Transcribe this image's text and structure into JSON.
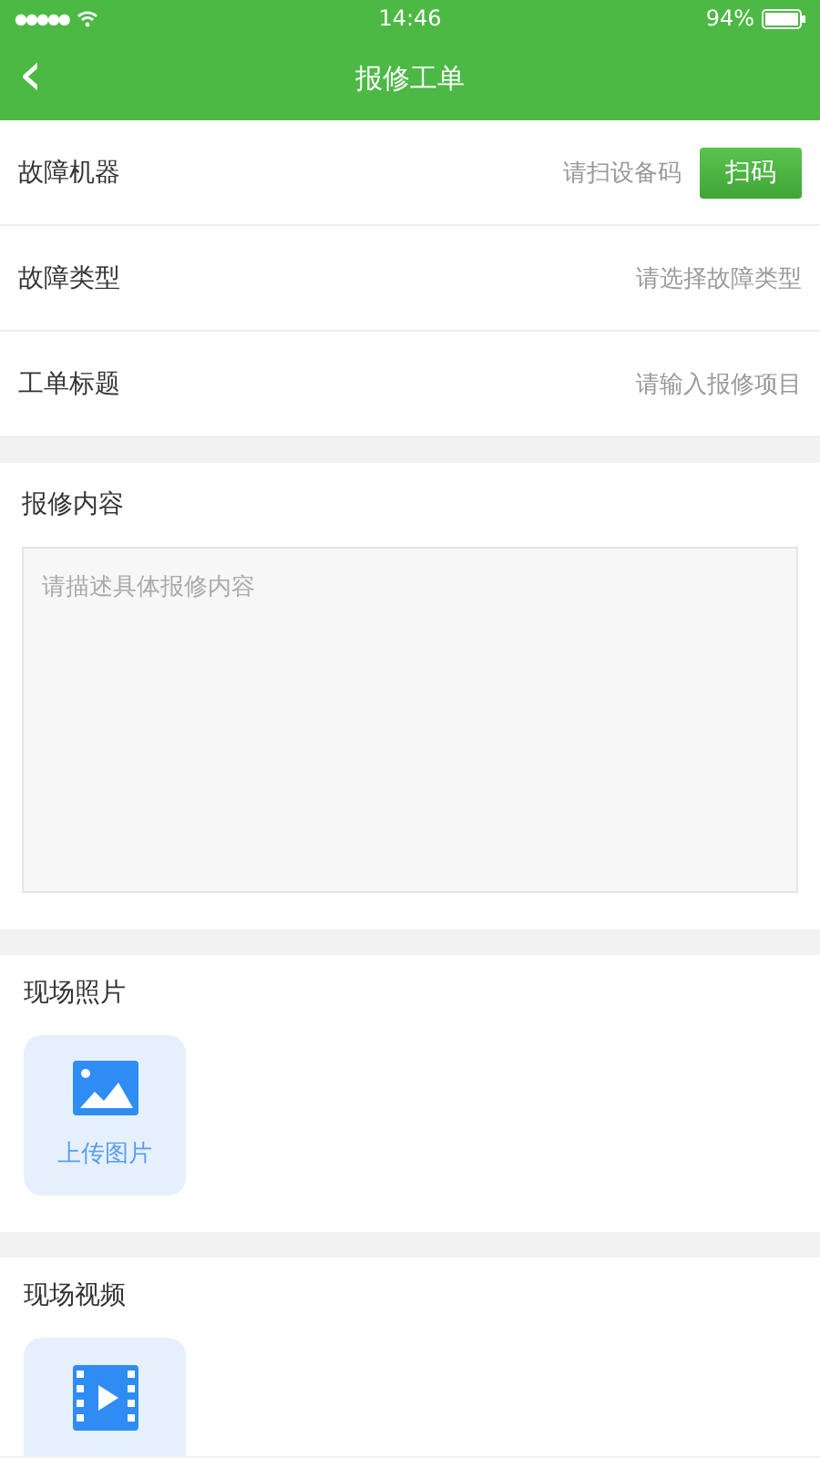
{
  "status_bar": {
    "signal": "●●●●●",
    "time": "14:46",
    "battery_percent": "94%"
  },
  "nav_bar": {
    "back": "‹",
    "title": "报修工单"
  },
  "form_rows": [
    {
      "label": "故障机器",
      "placeholder": "请扫设备码",
      "button": "扫码"
    },
    {
      "label": "故障类型",
      "placeholder": "请选择故障类型"
    },
    {
      "label": "工单标题",
      "placeholder": "请输入报修项目"
    }
  ],
  "content_section": {
    "title": "报修内容",
    "placeholder": "请描述具体报修内容"
  },
  "upload_sections": [
    {
      "title": "现场照片",
      "kind": "image",
      "label": "上传图片"
    },
    {
      "title": "现场视频",
      "kind": "video"
    }
  ]
}
